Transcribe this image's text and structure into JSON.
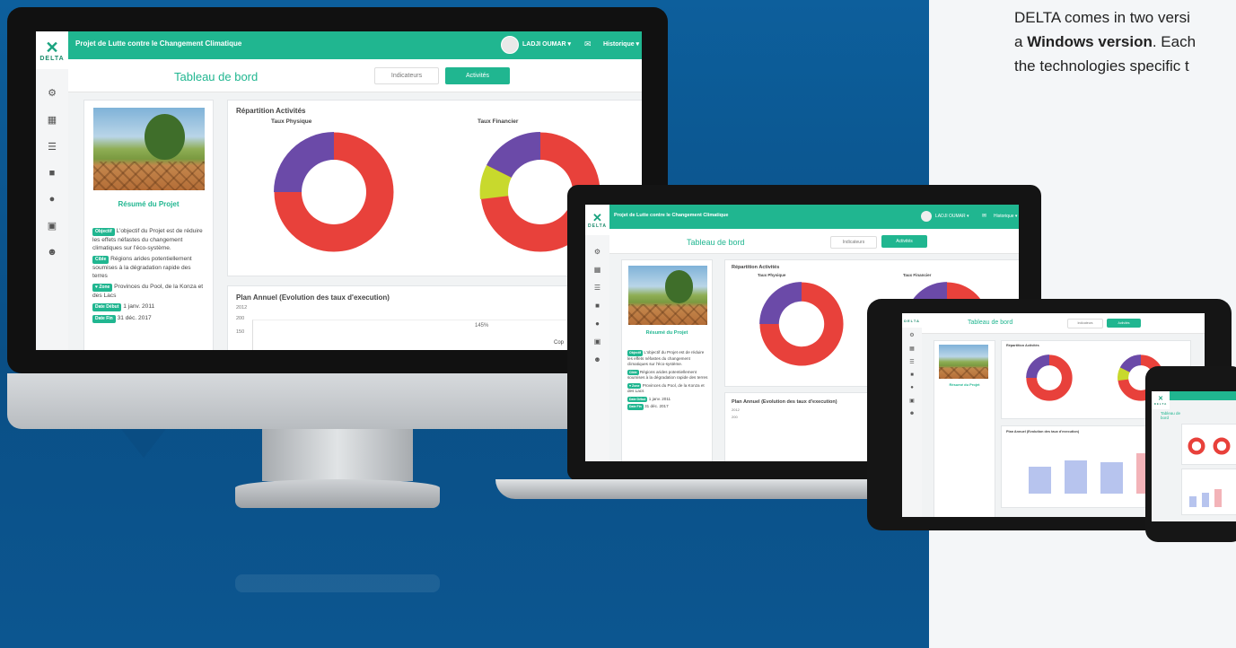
{
  "intro": {
    "line1": "DELTA comes in two versi",
    "line2_prefix": "a ",
    "line2_bold": "Windows version",
    "line2_suffix": ". Each",
    "line3": "the technologies specific t"
  },
  "app": {
    "logo": "DELTA",
    "title": "Projet de Lutte contre le Changement Climatique",
    "user": "LADJI OUMAR ▾",
    "history": "Historique ▾",
    "page_title": "Tableau de bord",
    "tab_indicators": "Indicateurs",
    "tab_activities": "Activités",
    "summary_title": "Résumé du Projet",
    "objectif_tag": "Objectif",
    "objectif_text": "L'objectif du Projet est de réduire les effets néfastes du changement climatiques sur l'éco-système.",
    "cible_tag": "Cible",
    "cible_text": "Régions arides potentiellement soumises à la dégradation rapide des terres",
    "zone_tag": "♥ Zone",
    "zone_text": "Provinces du Pool, de la Konza et des Lacs",
    "debut_tag": "Date Début",
    "debut_text": "1 janv. 2011",
    "fin_tag": "Date Fin",
    "fin_text": "31 déc. 2017",
    "repartition_title": "Répartition Activités",
    "taux_physique": "Taux Physique",
    "taux_financier": "Taux Financier",
    "plan_title": "Plan Annuel (Evolution des taux d'execution)",
    "plan_year": "2012",
    "plan_y_tick1": "200",
    "plan_y_tick2": "150",
    "plan_pct": "145%",
    "copyright": "Cop"
  },
  "charts": {
    "physique": {
      "red": 0.75,
      "purple": 0.25,
      "color_red": "#e8413b",
      "color_purple": "#6b4aa8"
    },
    "financier": {
      "red": 0.55,
      "yellow": 0.15,
      "purple": 0.3,
      "color_yellow": "#c8d92d"
    }
  },
  "colors": {
    "teal": "#20b690",
    "red": "#e8413b",
    "purple": "#6b4aa8",
    "yellow": "#c8d92d"
  }
}
